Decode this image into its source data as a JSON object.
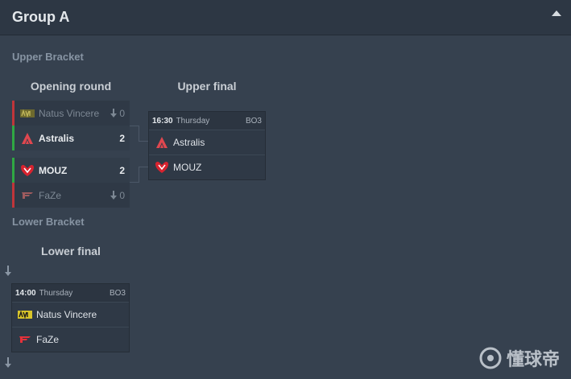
{
  "header": {
    "title": "Group A"
  },
  "upper_bracket": {
    "title": "Upper Bracket",
    "opening_round": {
      "title": "Opening round",
      "matches": [
        {
          "team1": {
            "name": "Natus Vincere",
            "score": "0",
            "result": "loss"
          },
          "team2": {
            "name": "Astralis",
            "score": "2",
            "result": "win"
          }
        },
        {
          "team1": {
            "name": "MOUZ",
            "score": "2",
            "result": "win"
          },
          "team2": {
            "name": "FaZe",
            "score": "0",
            "result": "loss"
          }
        }
      ]
    },
    "upper_final": {
      "title": "Upper final",
      "time": "16:30",
      "day": "Thursday",
      "format": "BO3",
      "team1": "Astralis",
      "team2": "MOUZ"
    }
  },
  "lower_bracket": {
    "title": "Lower Bracket",
    "lower_final": {
      "title": "Lower final",
      "time": "14:00",
      "day": "Thursday",
      "format": "BO3",
      "team1": "Natus Vincere",
      "team2": "FaZe"
    }
  },
  "watermark": {
    "text": "懂球帝"
  },
  "colors": {
    "win": "#2fa843",
    "loss": "#c0353a",
    "background": "#36414f"
  },
  "icons": [
    "navi-logo",
    "astralis-logo",
    "mouz-logo",
    "faze-logo",
    "download-arrow-icon",
    "collapse-up-icon"
  ]
}
